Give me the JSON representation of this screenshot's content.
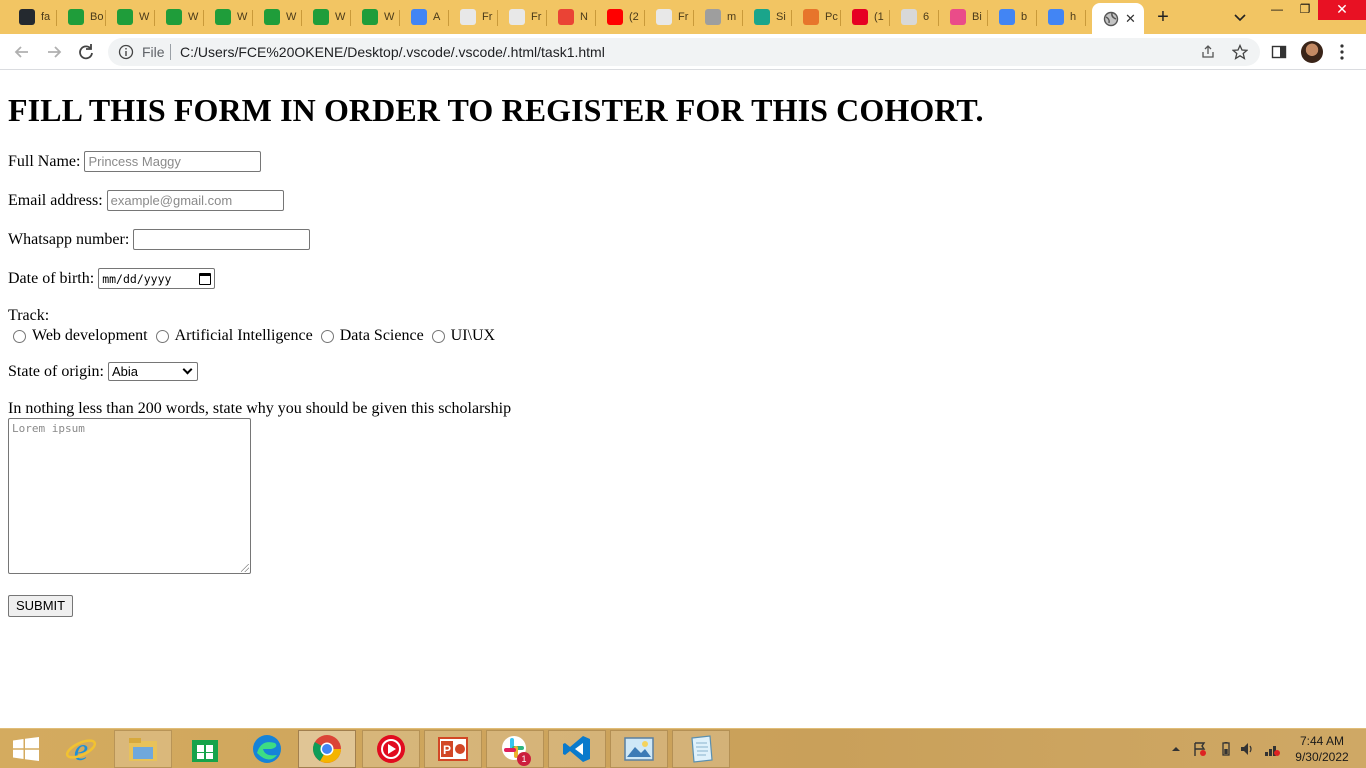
{
  "browser": {
    "tabs": [
      {
        "title": "fa",
        "icon": "github-icon",
        "color": "#24292f"
      },
      {
        "title": "Bo",
        "icon": "w-icon",
        "color": "#1f9d3a"
      },
      {
        "title": "W",
        "icon": "w-icon",
        "color": "#1f9d3a"
      },
      {
        "title": "W",
        "icon": "w-icon",
        "color": "#1f9d3a"
      },
      {
        "title": "W",
        "icon": "w-icon",
        "color": "#1f9d3a"
      },
      {
        "title": "W",
        "icon": "w-icon",
        "color": "#1f9d3a"
      },
      {
        "title": "W",
        "icon": "w-icon",
        "color": "#1f9d3a"
      },
      {
        "title": "W",
        "icon": "w-icon",
        "color": "#1f9d3a"
      },
      {
        "title": "A",
        "icon": "translate-icon",
        "color": "#4285f4"
      },
      {
        "title": "Fr",
        "icon": "smile-icon",
        "color": "#e8e8e8"
      },
      {
        "title": "Fr",
        "icon": "smile-icon",
        "color": "#e8e8e8"
      },
      {
        "title": "N",
        "icon": "gmail-icon",
        "color": "#ea4335"
      },
      {
        "title": "(2",
        "icon": "youtube-icon",
        "color": "#ff0000"
      },
      {
        "title": "Fr",
        "icon": "smile-icon",
        "color": "#e8e8e8"
      },
      {
        "title": "m",
        "icon": "gmail-gray-icon",
        "color": "#9e9e9e"
      },
      {
        "title": "Si",
        "icon": "diamond-icon",
        "color": "#1aa58b"
      },
      {
        "title": "Pc",
        "icon": "mountain-icon",
        "color": "#e7752b"
      },
      {
        "title": "(1",
        "icon": "pinterest-icon",
        "color": "#e60023"
      },
      {
        "title": "6",
        "icon": "page-icon",
        "color": "#d8d8d8"
      },
      {
        "title": "Bi",
        "icon": "dribbble-icon",
        "color": "#ea4c89"
      },
      {
        "title": "b",
        "icon": "google-icon",
        "color": "#4285f4"
      },
      {
        "title": "h",
        "icon": "google-icon",
        "color": "#4285f4"
      }
    ],
    "active_tab": {
      "icon": "globe-icon",
      "close": "✕"
    },
    "new_tab": "+",
    "address": {
      "scheme_label": "File",
      "url": "C:/Users/FCE%20OKENE/Desktop/.vscode/.vscode/.html/task1.html"
    }
  },
  "form": {
    "title": "FILL THIS FORM IN ORDER TO REGISTER FOR THIS COHORT.",
    "full_name": {
      "label": "Full Name:",
      "placeholder": "Princess Maggy"
    },
    "email": {
      "label": "Email address:",
      "placeholder": "example@gmail.com"
    },
    "whatsapp": {
      "label": "Whatsapp number:",
      "placeholder": ""
    },
    "dob": {
      "label": "Date of birth:",
      "placeholder": "mm/dd/yyyy"
    },
    "track": {
      "label": "Track:",
      "options": [
        "Web development",
        "Artificial Intelligence",
        "Data Science",
        "UI\\UX"
      ]
    },
    "state": {
      "label": "State of origin:",
      "selected": "Abia"
    },
    "essay": {
      "label": "In nothing less than 200 words, state why you should be given this scholarship",
      "placeholder": "Lorem ipsum"
    },
    "submit": "SUBMIT"
  },
  "taskbar": {
    "apps": [
      "ie-icon",
      "file-explorer-icon",
      "store-icon",
      "edge-icon",
      "chrome-icon",
      "media-player-icon",
      "powerpoint-icon",
      "slack-icon",
      "vscode-icon",
      "photos-icon",
      "notepad-icon"
    ],
    "slack_badge": "1",
    "time": "7:44 AM",
    "date": "9/30/2022"
  }
}
